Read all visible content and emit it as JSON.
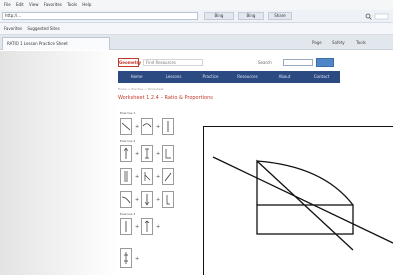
{
  "browser": {
    "menu": [
      "File",
      "Edit",
      "View",
      "Favorites",
      "Tools",
      "Help"
    ],
    "address_value": "http://...",
    "toolbar_buttons": [
      "Bing",
      "Bing",
      "Share"
    ],
    "favorites_label": "Favorites",
    "favorites_items": [
      "Suggested Sites"
    ],
    "tab_title": "RATIO 1 Lesson Practice Sheet",
    "tab_tools": [
      "Page",
      "Safety",
      "Tools"
    ]
  },
  "site": {
    "logo": "Geometry",
    "search_placeholder": "Find Resources",
    "search_label": "Search",
    "nav": [
      "Home",
      "Lessons",
      "Practice",
      "Resources",
      "About",
      "Contact"
    ],
    "breadcrumb": "Home > Practice > Worksheet",
    "heading": "Worksheet 1.2.4 – Ratio & Proportions",
    "sections": [
      {
        "label": "Exercise 1",
        "rows": 1
      },
      {
        "label": "Exercise 2",
        "rows": 4
      },
      {
        "label": "Exercise 3",
        "rows": 2
      }
    ]
  },
  "colors": {
    "nav_bg": "#2c4a82",
    "heading": "#c0392b",
    "logo": "#c13b2a",
    "go_button": "#4e86c8"
  },
  "icons": {
    "back": "back-arrow-icon",
    "forward": "forward-arrow-icon",
    "home": "home-icon",
    "search": "search-icon"
  }
}
